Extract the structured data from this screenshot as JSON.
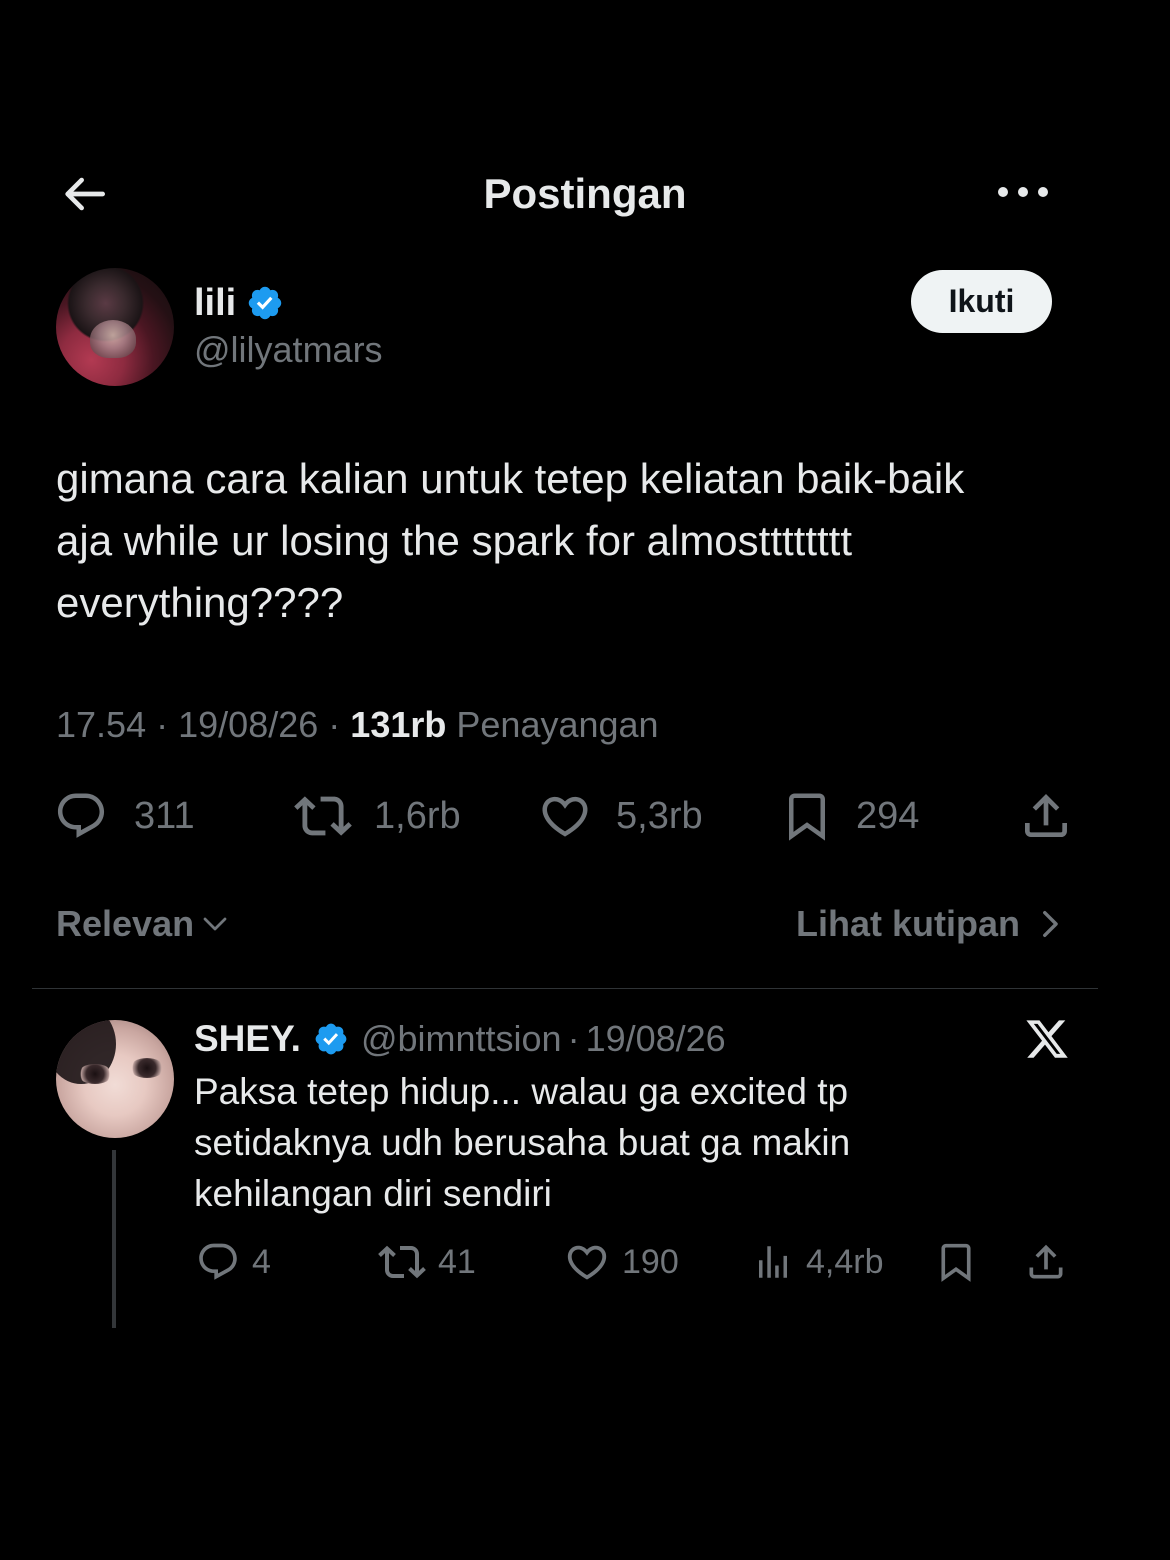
{
  "header": {
    "title": "Postingan",
    "back_icon": "arrow-left-icon",
    "more_icon": "more-horizontal-icon"
  },
  "post": {
    "author": {
      "name": "lili",
      "handle": "@lilyatmars",
      "verified": true
    },
    "follow_label": "Ikuti",
    "text": "gimana cara kalian untuk tetep keliatan baik-baik\naja while ur losing the spark for almostttttttt\neverything????",
    "time": "17.54",
    "date": "19/08/26",
    "views_count": "131rb",
    "views_label": "Penayangan",
    "separator": "·",
    "stats": {
      "replies": "311",
      "reposts": "1,6rb",
      "likes": "5,3rb",
      "bookmarks": "294"
    }
  },
  "sort": {
    "label": "Relevan",
    "quotes_label": "Lihat kutipan"
  },
  "reply": {
    "name": "SHEY.",
    "handle": "@bimnttsion",
    "separator": "·",
    "date": "19/08/26",
    "verified": true,
    "text": "Paksa tetep hidup... walau ga excited tp\nsetidaknya udh berusaha buat ga makin\nkehilangan diri sendiri",
    "stats": {
      "replies": "4",
      "reposts": "41",
      "likes": "190",
      "views": "4,4rb"
    }
  },
  "colors": {
    "background": "#000000",
    "text": "#e7e9ea",
    "secondary": "#71767b",
    "verified": "#1d9bf0",
    "divider": "#2f3336"
  }
}
